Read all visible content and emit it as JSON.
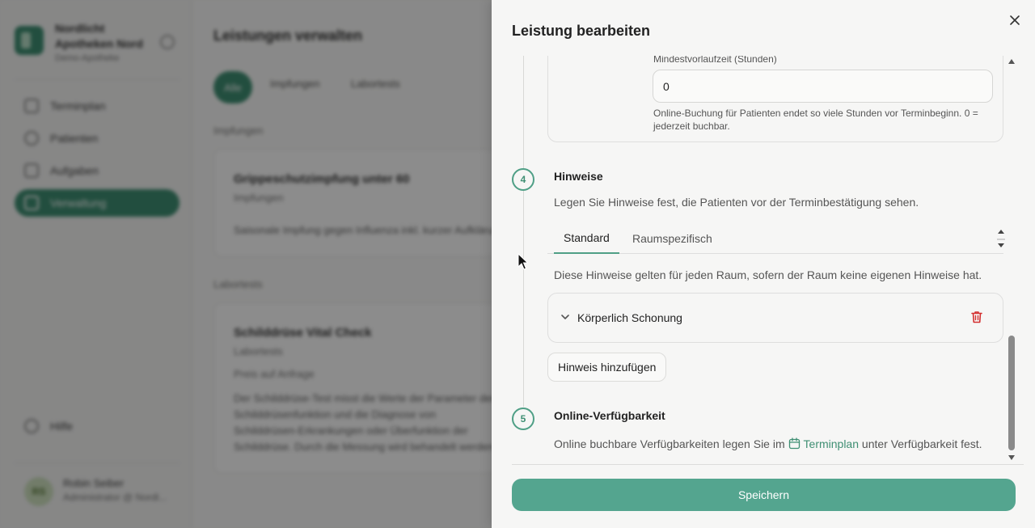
{
  "background": {
    "org_name": "Nordlicht Apotheken Nord",
    "org_sub": "Demo-Apotheke",
    "nav": [
      "Terminplan",
      "Patienten",
      "Aufgaben",
      "Verwaltung"
    ],
    "help": "Hilfe",
    "user_initials": "RS",
    "user_name": "Robin Seiber",
    "user_role": "Administrator @ Nordl...",
    "page_title": "Leistungen verwalten",
    "tabs": [
      "Alle",
      "Impfungen",
      "Labortests"
    ],
    "section_vaccinations": "Impfungen",
    "card1_title": "Grippeschutzimpfung unter 60",
    "card1_sub": "Impfungen",
    "card1_desc": "Saisonale Impfung gegen Influenza inkl. kurzer Aufklärung.",
    "section_labs": "Labortests",
    "card2_title": "Schilddrüse Vital Check",
    "card2_sub": "Labortests",
    "card2_price": "Preis auf Anfrage",
    "card2_desc": "Der Schilddrüse-Test misst die Werte der Parameter der Schilddrüsenfunktion und die Diagnose von Schilddrüsen-Erkrankungen oder Überfunktion der Schilddrüse. Durch die Messung wird behandelt werden."
  },
  "drawer": {
    "title": "Leistung bearbeiten",
    "lead_time": {
      "label": "Mindestvorlaufzeit (Stunden)",
      "value": "0",
      "help": "Online-Buchung für Patienten endet so viele Stunden vor Terminbeginn. 0 = jederzeit buchbar."
    },
    "step4": {
      "number": "4",
      "title": "Hinweise",
      "description": "Legen Sie Hinweise fest, die Patienten vor der Terminbestätigung sehen.",
      "tabs": [
        "Standard",
        "Raumspezifisch"
      ],
      "active_tab": "Standard",
      "tab_description": "Diese Hinweise gelten für jeden Raum, sofern der Raum keine eigenen Hinweise hat.",
      "hint_item": "Körperlich Schonung",
      "add_button": "Hinweis hinzufügen"
    },
    "step5": {
      "number": "5",
      "title": "Online-Verfügbarkeit",
      "desc_before": "Online buchbare Verfügbarkeiten legen Sie im",
      "link": "Terminplan",
      "desc_after": "unter Verfügbarkeit fest."
    },
    "save_button": "Speichern"
  },
  "colors": {
    "accent": "#54a58f",
    "accent_dark": "#3f8f73",
    "danger": "#d32f2f",
    "drawer_bg": "#f6f6f5"
  },
  "icons": [
    "close-icon",
    "chevron-down-icon",
    "trash-icon",
    "calendar-icon",
    "mouse-cursor-icon"
  ]
}
